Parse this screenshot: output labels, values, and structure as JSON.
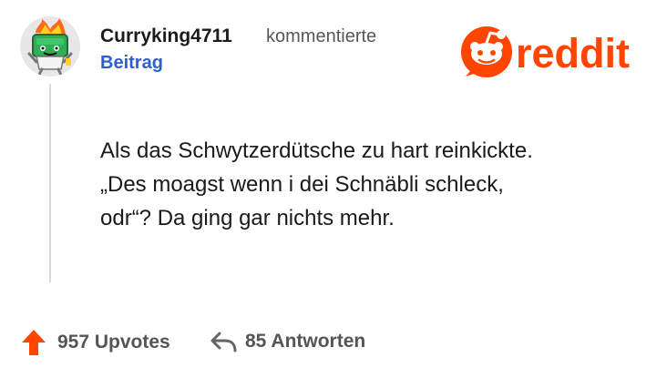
{
  "header": {
    "username": "Curryking4711",
    "action": "kommentierte",
    "post_link": "Beitrag"
  },
  "logo": {
    "text": "reddit",
    "brand_color": "#ff4500"
  },
  "comment": {
    "lines": [
      "Als das Schwytzerdütsche zu hart reinkickte.",
      "„Des moagst wenn i dei Schnäbli schleck,",
      "odr“? Da ging gar nichts mehr."
    ]
  },
  "footer": {
    "upvotes": "957 Upvotes",
    "replies": "85 Antworten",
    "upvote_icon": "up-arrow-icon",
    "reply_icon": "reply-arrow-icon",
    "upvote_color": "#ff4500"
  }
}
